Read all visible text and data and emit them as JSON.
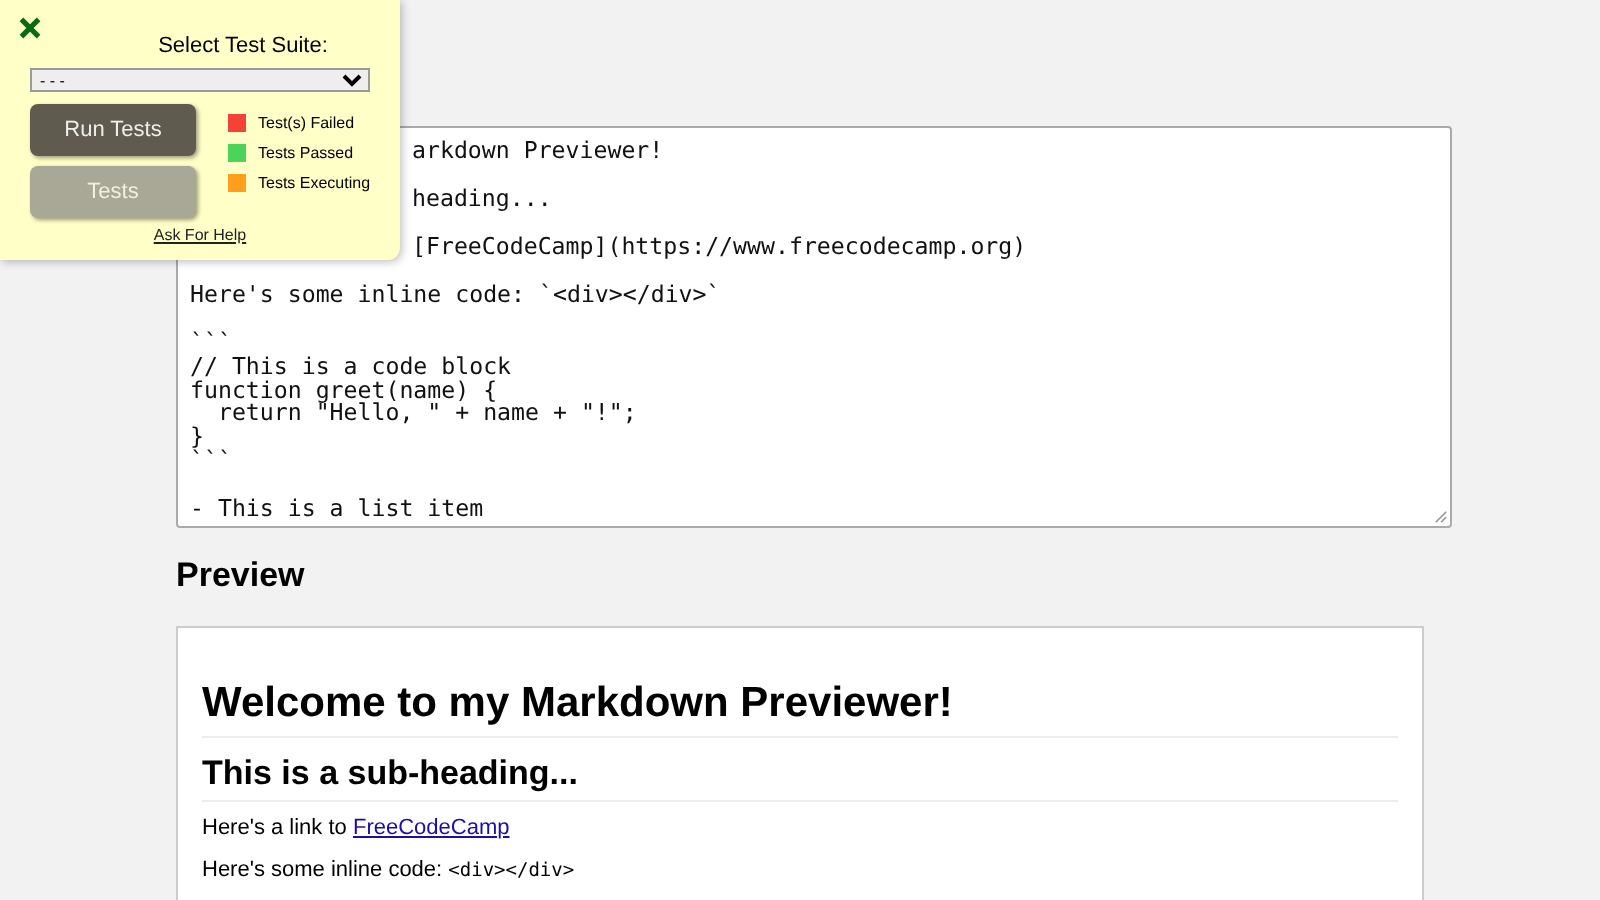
{
  "editor": {
    "paragraphs": [
      {
        "lines": [
          "arkdown Previewer!"
        ],
        "starts_under_panel": true
      },
      {
        "lines": [
          "heading..."
        ],
        "starts_under_panel": true
      },
      {
        "lines": [
          "[FreeCodeCamp](https://www.freecodecamp.org)"
        ],
        "starts_under_panel": true
      },
      {
        "lines": [
          "Here's some inline code: `<div></div>`"
        ],
        "starts_under_panel": false
      },
      {
        "lines": [
          "```",
          "// This is a code block",
          "function greet(name) {",
          "  return \"Hello, \" + name + \"!\";",
          "}",
          "```"
        ],
        "starts_under_panel": false
      },
      {
        "lines": [
          "- This is a list item"
        ],
        "starts_under_panel": false
      }
    ]
  },
  "preview": {
    "heading": "Preview",
    "h1": "Welcome to my Markdown Previewer!",
    "h2": "This is a sub-heading...",
    "link_text": "Here's a link to",
    "link": "FreeCodeCamp",
    "code_text": "Here's some inline code:",
    "code": "<div></div>"
  },
  "test_panel": {
    "title": "Select Test Suite:",
    "suite": "- - -",
    "buttons": [
      {
        "label": "Run Tests",
        "kind": "run"
      },
      {
        "label": "Tests",
        "kind": "tests"
      }
    ],
    "legend": [
      {
        "label": "Test(s) Failed",
        "color": "#f44336"
      },
      {
        "label": "Tests Passed",
        "color": "#4cd35a"
      },
      {
        "label": "Tests Executing",
        "color": "#ff9f1c"
      }
    ],
    "help": "Ask For Help"
  }
}
